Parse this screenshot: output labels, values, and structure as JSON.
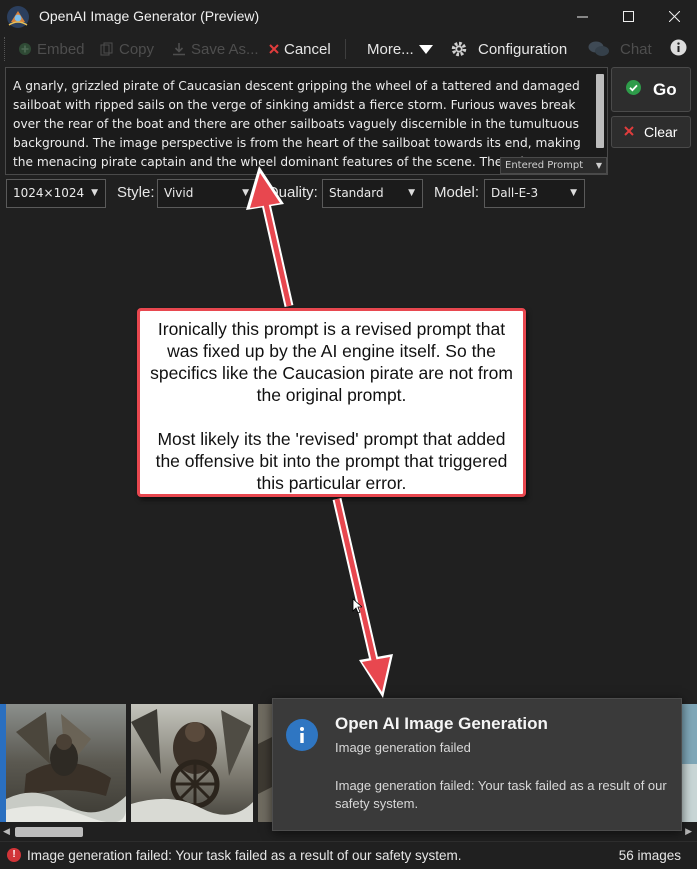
{
  "window": {
    "title": "OpenAI Image Generator (Preview)",
    "minimize_icon": "minimize-icon",
    "maximize_icon": "maximize-icon",
    "close_icon": "close-icon"
  },
  "toolbar": {
    "embed": "Embed",
    "copy": "Copy",
    "save_as": "Save As...",
    "cancel": "Cancel",
    "more": "More...",
    "configuration": "Configuration",
    "chat": "Chat"
  },
  "prompt": {
    "text": "A gnarly, grizzled pirate of Caucasian descent gripping the wheel of a tattered and damaged sailboat with ripped sails on the verge of sinking amidst a fierce storm. Furious waves break over the rear of the boat and there are other sailboats vaguely discernible in the tumultuous background. The image perspective is from the heart of the sailboat towards its end, making the menacing pirate captain and the wheel dominant features of the scene. The color scheme",
    "mode_label": "Entered Prompt"
  },
  "actions": {
    "go": "Go",
    "clear": "Clear"
  },
  "options": {
    "size_value": "1024×1024",
    "style_label": "Style:",
    "style_value": "Vivid",
    "quality_label": "Quality:",
    "quality_value": "Standard",
    "model_label": "Model:",
    "model_value": "Dall-E-3"
  },
  "annotation": {
    "paragraph1": "Ironically this prompt is a revised prompt that was fixed up by the AI engine itself. So the specifics like the Caucasion pirate are not from the original prompt.",
    "paragraph2": "Most likely its the 'revised' prompt that added the offensive bit into the prompt that triggered this particular error.",
    "border_color": "#e8474f"
  },
  "toast": {
    "title": "Open AI Image Generation",
    "subtitle": "Image generation failed",
    "body": "Image generation failed: Your task failed as a result of our safety system."
  },
  "status": {
    "message": "Image generation failed: Your task failed as a result of our safety system.",
    "image_count": "56 images"
  },
  "colors": {
    "background": "#202020",
    "go_check": "#2e9c4a",
    "clear_x": "#e03c3c",
    "info_blue": "#2f76c2",
    "error_red": "#d13438"
  }
}
